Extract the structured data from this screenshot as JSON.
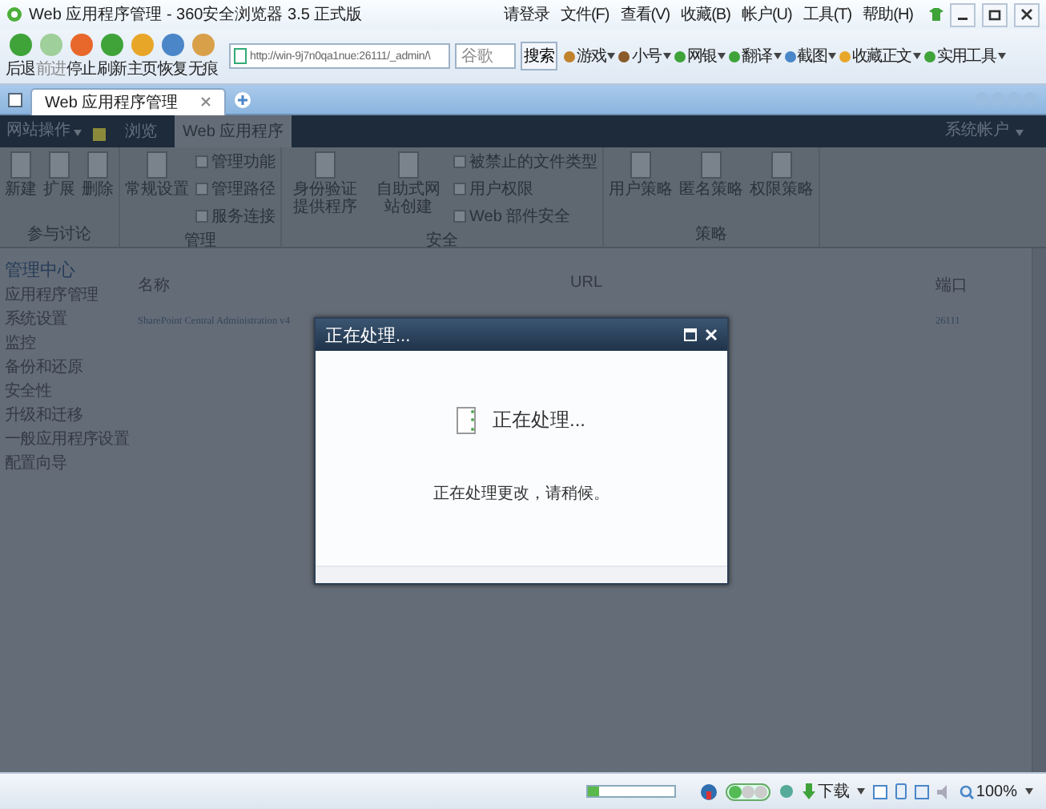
{
  "browser": {
    "title": "Web 应用程序管理 - 360安全浏览器 3.5 正式版",
    "login": "请登录",
    "menu": [
      "文件(F)",
      "查看(V)",
      "收藏(B)",
      "帐户(U)",
      "工具(T)",
      "帮助(H)"
    ],
    "nav_buttons": [
      {
        "label": "后退",
        "disabled": false,
        "color": "#3fa33a"
      },
      {
        "label": "前进",
        "disabled": true,
        "color": "#9fcf9a"
      },
      {
        "label": "停止",
        "disabled": false,
        "color": "#e8672a"
      },
      {
        "label": "刷新",
        "disabled": false,
        "color": "#3fa33a"
      },
      {
        "label": "主页",
        "disabled": false,
        "color": "#e8a628"
      },
      {
        "label": "恢复",
        "disabled": false,
        "color": "#4a86c8"
      },
      {
        "label": "无痕",
        "disabled": false,
        "color": "#d9a04a"
      }
    ],
    "address": "http://win-9j7n0qa1nue:26111/_admin/\\",
    "search_placeholder": "谷歌",
    "search_button": "搜索",
    "tools": [
      {
        "label": "游戏",
        "color": "#c0822a"
      },
      {
        "label": "小号",
        "color": "#8a5a2a"
      },
      {
        "label": "网银",
        "color": "#3fa33a"
      },
      {
        "label": "翻译",
        "color": "#3fa33a"
      },
      {
        "label": "截图",
        "color": "#4a86c8"
      },
      {
        "label": "收藏正文",
        "color": "#e8a628"
      },
      {
        "label": "实用工具",
        "color": "#3fa33a"
      }
    ],
    "tabs": [
      {
        "label": "Web 应用程序管理",
        "selected": true
      }
    ]
  },
  "ribbon": {
    "site_actions": "网站操作",
    "tabs": [
      {
        "label": "浏览",
        "selected": false
      },
      {
        "label": "Web 应用程序",
        "selected": true
      }
    ],
    "user": "系统帐户",
    "groups": [
      {
        "label": "参与讨论",
        "items": [
          {
            "kind": "large",
            "label": "新建"
          },
          {
            "kind": "large",
            "label": "扩展"
          },
          {
            "kind": "large",
            "label": "删除"
          }
        ]
      },
      {
        "label": "管理",
        "items": [
          {
            "kind": "large",
            "label": "常规设置"
          },
          {
            "kind": "small",
            "label": "管理功能"
          },
          {
            "kind": "small",
            "label": "管理路径"
          },
          {
            "kind": "small",
            "label": "服务连接"
          }
        ]
      },
      {
        "label": "安全",
        "items": [
          {
            "kind": "large",
            "label": "身份验证提供程序"
          },
          {
            "kind": "large",
            "label": "自助式网站创建"
          },
          {
            "kind": "small",
            "label": "被禁止的文件类型"
          },
          {
            "kind": "small",
            "label": "用户权限"
          },
          {
            "kind": "small",
            "label": "Web 部件安全"
          }
        ]
      },
      {
        "label": "策略",
        "items": [
          {
            "kind": "large",
            "label": "用户策略"
          },
          {
            "kind": "large",
            "label": "匿名策略"
          },
          {
            "kind": "large",
            "label": "权限策略"
          }
        ]
      }
    ]
  },
  "left_nav": {
    "heading": "管理中心",
    "items": [
      "应用程序管理",
      "系统设置",
      "监控",
      "备份和还原",
      "安全性",
      "升级和迁移",
      "一般应用程序设置",
      "配置向导"
    ]
  },
  "table": {
    "columns": [
      "名称",
      "URL",
      "端口"
    ],
    "rows": [
      [
        "SharePoint Central Administration v4",
        "",
        "26111"
      ]
    ]
  },
  "dialog": {
    "title": "正在处理...",
    "message": "正在处理...",
    "detail": "正在处理更改，请稍候。"
  },
  "status_bar": {
    "level": 0.12,
    "download": "下载",
    "zoom": "100%"
  }
}
